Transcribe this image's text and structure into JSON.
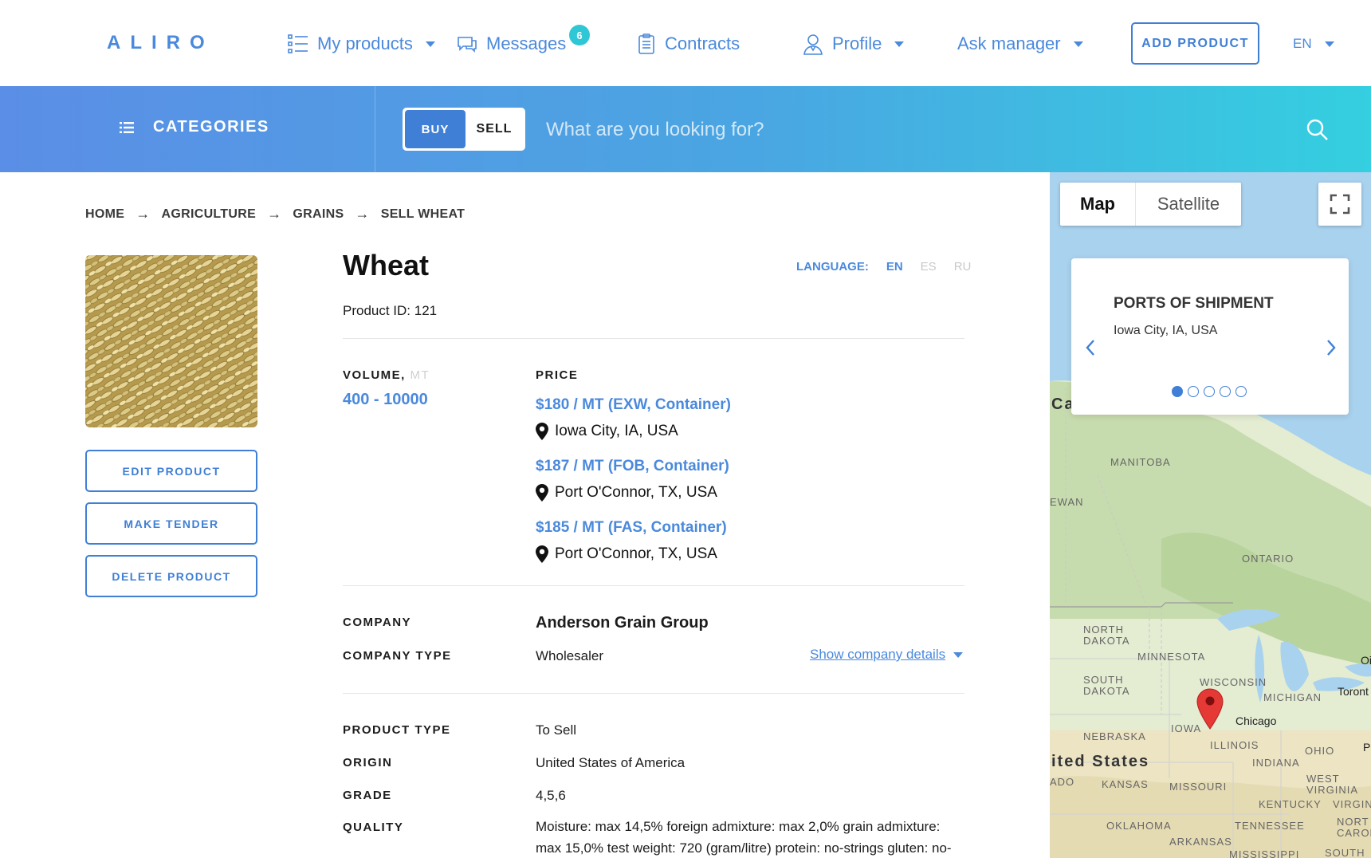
{
  "header": {
    "logo": "ALIRO",
    "nav": {
      "products": "My products",
      "messages": "Messages",
      "messages_count": "6",
      "contracts": "Contracts",
      "profile": "Profile",
      "ask_manager": "Ask manager"
    },
    "add_product": "ADD PRODUCT",
    "language": "EN"
  },
  "search_band": {
    "categories": "CATEGORIES",
    "buy": "BUY",
    "sell": "SELL",
    "placeholder": "What are you looking for?"
  },
  "breadcrumb": [
    "HOME",
    "AGRICULTURE",
    "GRAINS",
    "SELL WHEAT"
  ],
  "sidebar": {
    "edit": "EDIT PRODUCT",
    "tender": "MAKE TENDER",
    "delete": "DELETE PRODUCT"
  },
  "product": {
    "title": "Wheat",
    "id_text": "Product ID: 121",
    "language_label": "LANGUAGE:",
    "languages": {
      "en": "EN",
      "es": "ES",
      "ru": "RU"
    },
    "volume_label": "VOLUME,",
    "volume_unit": "MT",
    "volume_value": "400 - 10000",
    "price_label": "PRICE",
    "prices": [
      {
        "price": "$180 / MT (EXW, Container)",
        "location": "Iowa City, IA, USA"
      },
      {
        "price": "$187 / MT (FOB, Container)",
        "location": "Port O'Connor, TX, USA"
      },
      {
        "price": "$185 / MT (FAS, Container)",
        "location": "Port O'Connor, TX, USA"
      }
    ],
    "company_label": "COMPANY",
    "company_value": "Anderson Grain Group",
    "company_type_label": "COMPANY TYPE",
    "company_type_value": "Wholesaler",
    "show_details": "Show company details",
    "product_type_label": "PRODUCT TYPE",
    "product_type_value": "To Sell",
    "origin_label": "ORIGIN",
    "origin_value": "United States of America",
    "grade_label": "GRADE",
    "grade_value": "4,5,6",
    "quality_label": "QUALITY",
    "quality_value": "Moisture: max 14,5% foreign admixture: max 2,0% grain admixture: max 15,0% test weight: 720 (gram/litre) protein: no-strings gluten: no-"
  },
  "map": {
    "tab_map": "Map",
    "tab_satellite": "Satellite",
    "ports_title": "PORTS OF SHIPMENT",
    "ports_city": "Iowa City, IA, USA",
    "labels": {
      "canada": "Canada",
      "manitoba": "MANITOBA",
      "ewan": "EWAN",
      "ontario": "ONTARIO",
      "north_dakota": "NORTH DAKOTA",
      "minnesota": "MINNESOTA",
      "south_dakota": "SOUTH DAKOTA",
      "wisconsin": "WISCONSIN",
      "michigan": "MICHIGAN",
      "toronto": "Toront",
      "chicago": "Chicago",
      "iowa": "IOWA",
      "nebraska": "NEBRASKA",
      "illinois": "ILLINOIS",
      "ohio": "OHIO",
      "united_states": "ited States",
      "indiana": "INDIANA",
      "kansas": "KANSAS",
      "missouri": "MISSOURI",
      "west_virginia": "WEST VIRGINIA",
      "kentucky": "KENTUCKY",
      "oklahoma": "OKLAHOMA",
      "tennessee": "TENNESSEE",
      "arkansas": "ARKANSAS",
      "mississippi": "MISSISSIPPI",
      "south": "SOUTH",
      "ado": "ADO",
      "virgin": "VIRGIN",
      "north_carol": "NORT CAROL",
      "oi": "Oi",
      "p": "P"
    }
  },
  "colors": {
    "accent": "#3f7fd6",
    "band_start": "#5b8ee6",
    "band_end": "#34cfe0",
    "pin": "#e53935"
  }
}
